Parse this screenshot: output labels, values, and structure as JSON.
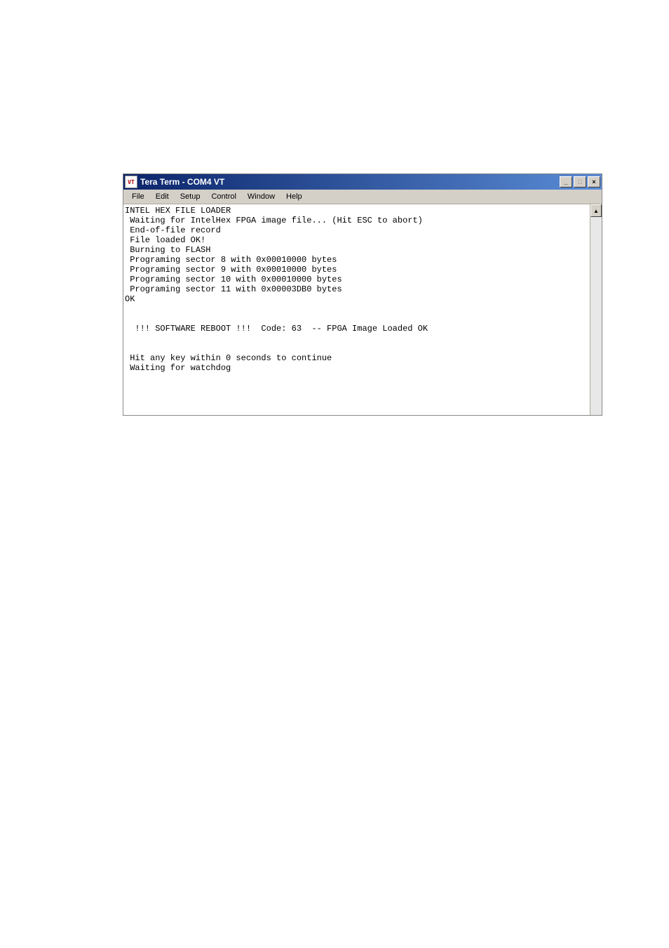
{
  "window": {
    "title": "Tera Term - COM4 VT",
    "icon_label": "VT"
  },
  "menu": {
    "items": [
      "File",
      "Edit",
      "Setup",
      "Control",
      "Window",
      "Help"
    ]
  },
  "controls": {
    "minimize": "_",
    "maximize": "□",
    "close": "×"
  },
  "terminal": {
    "lines": [
      "INTEL HEX FILE LOADER",
      " Waiting for IntelHex FPGA image file... (Hit ESC to abort)",
      " End-of-file record",
      " File loaded OK!",
      " Burning to FLASH",
      " Programing sector 8 with 0x00010000 bytes",
      " Programing sector 9 with 0x00010000 bytes",
      " Programing sector 10 with 0x00010000 bytes",
      " Programing sector 11 with 0x00003DB0 bytes",
      "OK",
      "",
      "",
      "  !!! SOFTWARE REBOOT !!!  Code: 63  -- FPGA Image Loaded OK",
      "",
      "",
      " Hit any key within 0 seconds to continue",
      " Waiting for watchdog"
    ]
  },
  "scrollbar": {
    "up": "▲",
    "down": "▼"
  }
}
